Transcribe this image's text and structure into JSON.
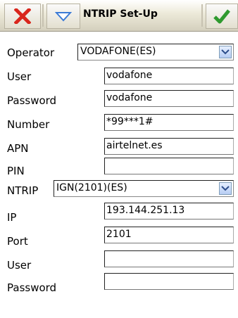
{
  "titlebar": {
    "title": "NTRIP Set-Up",
    "close_icon": "close-x-icon",
    "menu_icon": "dropdown-triangle-icon",
    "ok_icon": "checkmark-icon",
    "close_color": "#d9261c",
    "menu_color": "#3b7bd6",
    "ok_color": "#2f9a2f"
  },
  "form": {
    "operator": {
      "label": "Operator",
      "value": "VODAFONE(ES)"
    },
    "user": {
      "label": "User",
      "value": "vodafone"
    },
    "password": {
      "label": "Password",
      "value": "vodafone"
    },
    "number": {
      "label": "Number",
      "value": "*99***1#"
    },
    "apn": {
      "label": "APN",
      "value": "airtelnet.es"
    },
    "pin": {
      "label": "PIN",
      "value": ""
    },
    "ntrip": {
      "label": "NTRIP",
      "value": "IGN(2101)(ES)"
    },
    "ip": {
      "label": "IP",
      "value": "193.144.251.13"
    },
    "port": {
      "label": "Port",
      "value": "2101"
    },
    "ntrip_user": {
      "label": "User",
      "value": ""
    },
    "ntrip_password": {
      "label": "Password",
      "value": ""
    }
  }
}
